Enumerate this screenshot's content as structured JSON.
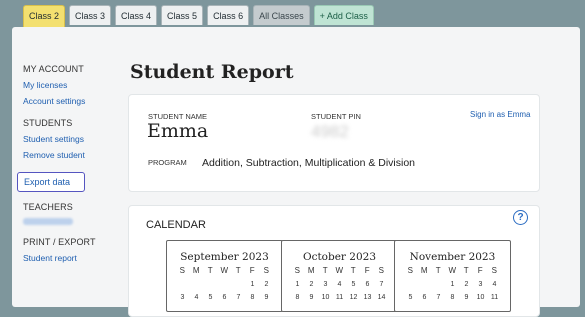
{
  "tabs": [
    {
      "label": "Class 2",
      "state": "active"
    },
    {
      "label": "Class 3",
      "state": "normal"
    },
    {
      "label": "Class 4",
      "state": "normal"
    },
    {
      "label": "Class 5",
      "state": "normal"
    },
    {
      "label": "Class 6",
      "state": "normal"
    },
    {
      "label": "All Classes",
      "state": "muted"
    },
    {
      "label": "+ Add Class",
      "state": "add"
    }
  ],
  "sidebar": {
    "my_account": {
      "heading": "MY ACCOUNT",
      "links": [
        "My licenses",
        "Account settings"
      ]
    },
    "students": {
      "heading": "STUDENTS",
      "links": [
        "Student settings",
        "Remove student"
      ]
    },
    "export_label": "Export data",
    "teachers": {
      "heading": "TEACHERS"
    },
    "print_export": {
      "heading": "PRINT / EXPORT",
      "links": [
        "Student report"
      ]
    }
  },
  "page": {
    "title": "Student Report"
  },
  "student": {
    "name_label": "STUDENT NAME",
    "name": "Emma",
    "pin_label": "STUDENT PIN",
    "pin": "4982",
    "sign_in": "Sign in as Emma",
    "program_label": "PROGRAM",
    "program": "Addition, Subtraction, Multiplication & Division"
  },
  "calendar": {
    "title": "CALENDAR",
    "help_icon": "help-circle-icon",
    "days": [
      "S",
      "M",
      "T",
      "W",
      "T",
      "F",
      "S"
    ],
    "months": [
      {
        "name": "September 2023",
        "row1": [
          "",
          "",
          "",
          "",
          "",
          "1",
          "2"
        ],
        "row2": [
          "3",
          "4",
          "5",
          "6",
          "7",
          "8",
          "9"
        ]
      },
      {
        "name": "October 2023",
        "row1": [
          "1",
          "2",
          "3",
          "4",
          "5",
          "6",
          "7"
        ],
        "row2": [
          "8",
          "9",
          "10",
          "11",
          "12",
          "13",
          "14"
        ]
      },
      {
        "name": "November 2023",
        "row1": [
          "",
          "",
          "",
          "1",
          "2",
          "3",
          "4"
        ],
        "row2": [
          "5",
          "6",
          "7",
          "8",
          "9",
          "10",
          "11"
        ]
      }
    ]
  },
  "colors": {
    "accent_tab": "#f3e070",
    "link": "#1f5fb0",
    "background": "#7e969c"
  }
}
